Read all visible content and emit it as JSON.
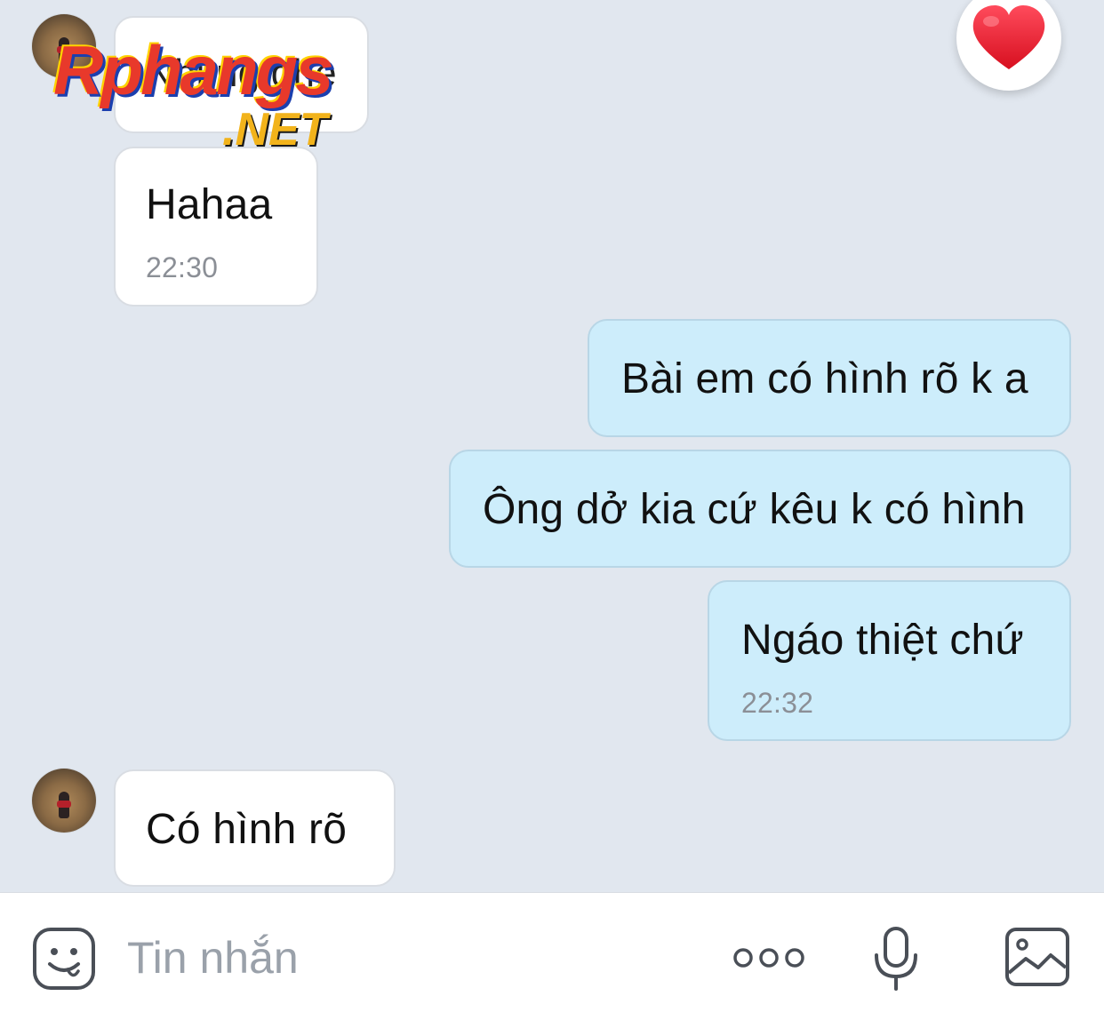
{
  "messages": [
    {
      "side": "in",
      "text": "Nhỉ ng ghe",
      "time": ""
    },
    {
      "side": "in",
      "text": "Hahaa",
      "time": "22:30"
    },
    {
      "side": "out",
      "text": "Bài em có hình rõ k a",
      "time": ""
    },
    {
      "side": "out",
      "text": "Ông dở kia cứ kêu k có hình",
      "time": ""
    },
    {
      "side": "out",
      "text": "Ngáo thiệt chứ",
      "time": "22:32"
    },
    {
      "side": "in",
      "text": "Có hình rõ",
      "time": ""
    }
  ],
  "watermark": {
    "main": "Rphangs",
    "suffix": ".NET"
  },
  "composer": {
    "placeholder": "Tin nhắn"
  },
  "icons": {
    "reaction": "heart-icon",
    "sticker": "sticker-face-icon",
    "more": "more-dots-icon",
    "voice": "microphone-icon",
    "photo": "image-icon"
  },
  "colors": {
    "background": "#e1e7ef",
    "incoming_bubble": "#ffffff",
    "outgoing_bubble": "#cdedfb",
    "heart": "#e8192c"
  }
}
